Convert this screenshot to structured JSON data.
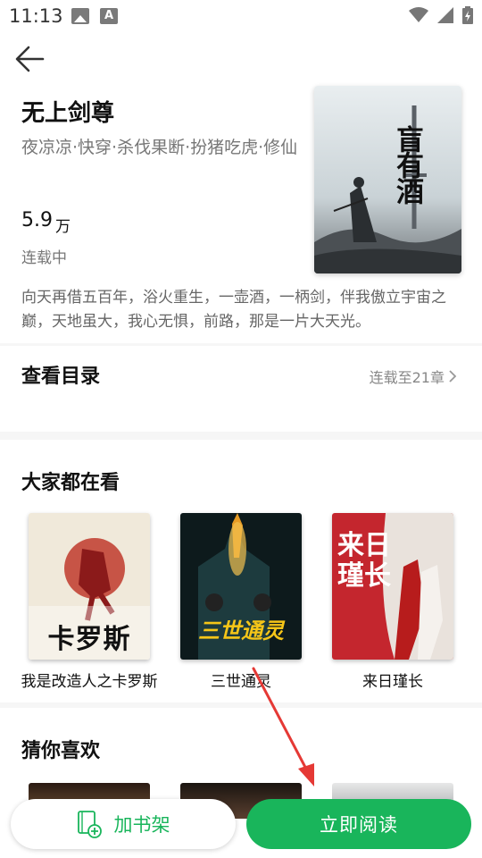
{
  "status_bar": {
    "time": "11:13",
    "left_icons": [
      "image-icon",
      "a-icon"
    ],
    "right_icons": [
      "wifi-icon",
      "signal-icon",
      "battery-icon"
    ]
  },
  "header": {
    "back_icon": "arrow-left-icon"
  },
  "book": {
    "title": "无上剑尊",
    "meta": "夜凉凉·快穿·杀伐果断·扮猪吃虎·修仙",
    "word_count": "5.9",
    "word_unit": "万",
    "status": "连载中",
    "cover_text": "盲有酒",
    "description": "向天再借五百年，浴火重生，一壶酒，一柄剑，伴我傲立宇宙之巅，天地虽大，我心无惧，前路，那是一片大天光。"
  },
  "toc": {
    "title": "查看目录",
    "latest": "连载至21章"
  },
  "popular": {
    "title": "大家都在看",
    "books": [
      {
        "name": "我是改造人之卡罗斯",
        "cover_text": "卡罗斯"
      },
      {
        "name": "三世通灵",
        "cover_text": "三世通灵"
      },
      {
        "name": "来日瑾长",
        "cover_text": "来日瑾长"
      }
    ]
  },
  "guess": {
    "title": "猜你喜欢"
  },
  "actions": {
    "shelf_label": "加书架",
    "read_label": "立即阅读"
  },
  "colors": {
    "accent": "#19b55b",
    "annotation_arrow": "#e53935"
  }
}
